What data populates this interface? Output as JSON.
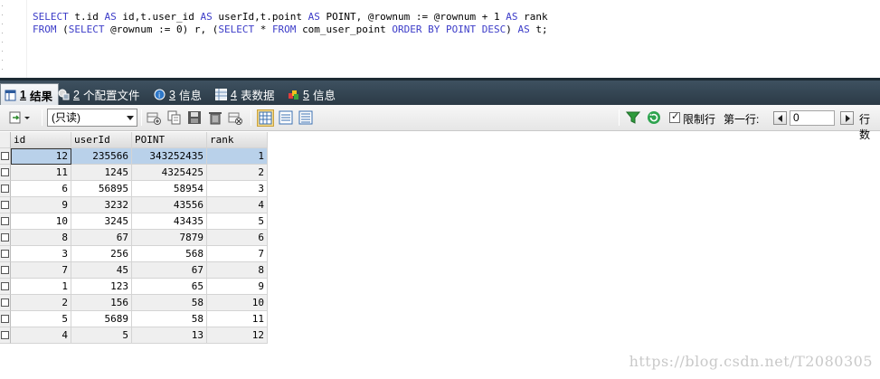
{
  "editor": {
    "line1": [
      {
        "t": "SELECT ",
        "k": "kw"
      },
      {
        "t": "t.id ",
        "k": "id"
      },
      {
        "t": "AS ",
        "k": "kw"
      },
      {
        "t": "id,t.user_id ",
        "k": "id"
      },
      {
        "t": "AS ",
        "k": "kw"
      },
      {
        "t": "userId,t.point ",
        "k": "id"
      },
      {
        "t": "AS ",
        "k": "kw"
      },
      {
        "t": "POINT, @rownum := @rownum + 1 ",
        "k": "id"
      },
      {
        "t": "AS ",
        "k": "kw"
      },
      {
        "t": "rank",
        "k": "id"
      }
    ],
    "line2": [
      {
        "t": "FROM ",
        "k": "kw"
      },
      {
        "t": "(",
        "k": "id"
      },
      {
        "t": "SELECT ",
        "k": "kw"
      },
      {
        "t": "@rownum := 0) r, (",
        "k": "id"
      },
      {
        "t": "SELECT ",
        "k": "kw"
      },
      {
        "t": "* ",
        "k": "id"
      },
      {
        "t": "FROM ",
        "k": "kw"
      },
      {
        "t": "com_user_point ",
        "k": "id"
      },
      {
        "t": "ORDER BY ",
        "k": "kw"
      },
      {
        "t": "POINT ",
        "k": "kw"
      },
      {
        "t": "DESC",
        "k": "kw"
      },
      {
        "t": ") ",
        "k": "id"
      },
      {
        "t": "AS ",
        "k": "kw"
      },
      {
        "t": "t;",
        "k": "id"
      }
    ]
  },
  "tabs": [
    {
      "num": "1",
      "label": "结果",
      "icon": "grid-result-icon",
      "active": true
    },
    {
      "num": "2",
      "label": "个配置文件",
      "icon": "profile-icon",
      "active": false
    },
    {
      "num": "3",
      "label": "信息",
      "icon": "info-icon",
      "active": false
    },
    {
      "num": "4",
      "label": "表数据",
      "icon": "table-data-icon",
      "active": false
    },
    {
      "num": "5",
      "label": "信息",
      "icon": "info-colored-icon",
      "active": false
    }
  ],
  "toolbar": {
    "readonly_select": "(只读)",
    "limit_rows_label": "限制行",
    "limit_rows_checked": true,
    "first_row_label": "第一行:",
    "first_row_value": "0",
    "rows_label": "行数"
  },
  "grid": {
    "columns": [
      "id",
      "userId",
      "POINT",
      "rank"
    ],
    "rows": [
      [
        "12",
        "235566",
        "343252435",
        "1"
      ],
      [
        "11",
        "1245",
        "4325425",
        "2"
      ],
      [
        "6",
        "56895",
        "58954",
        "3"
      ],
      [
        "9",
        "3232",
        "43556",
        "4"
      ],
      [
        "10",
        "3245",
        "43435",
        "5"
      ],
      [
        "8",
        "67",
        "7879",
        "6"
      ],
      [
        "3",
        "256",
        "568",
        "7"
      ],
      [
        "7",
        "45",
        "67",
        "8"
      ],
      [
        "1",
        "123",
        "65",
        "9"
      ],
      [
        "2",
        "156",
        "58",
        "10"
      ],
      [
        "5",
        "5689",
        "58",
        "11"
      ],
      [
        "4",
        "5",
        "13",
        "12"
      ]
    ],
    "selected_row": 0
  },
  "watermark": "https://blog.csdn.net/T2080305",
  "colors": {
    "keyword": "#3c3cc8",
    "tabbar": "#2f3f4c",
    "selection": "#b9d1ea"
  }
}
